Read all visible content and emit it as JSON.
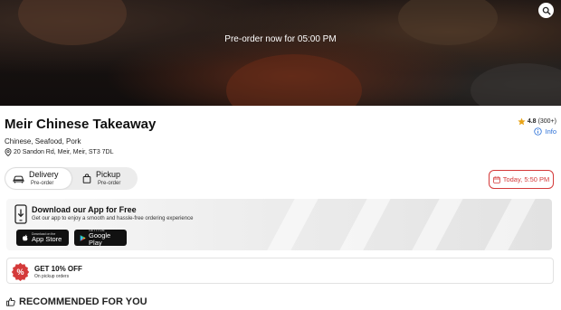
{
  "hero": {
    "preorder_text": "Pre-order now for 05:00 PM"
  },
  "restaurant": {
    "name": "Meir Chinese Takeaway",
    "cuisines": "Chinese, Seafood, Pork",
    "address": "20 Sandon Rd, Meir, Meir, ST3 7DL",
    "rating": "4.8",
    "rating_count": "(300+)",
    "info_label": "Info"
  },
  "order_mode": {
    "delivery": {
      "label": "Delivery",
      "sub": "Pre-order"
    },
    "pickup": {
      "label": "Pickup",
      "sub": "Pre-order"
    },
    "selected": "delivery"
  },
  "schedule": {
    "label": "Today, 5:50 PM"
  },
  "app_banner": {
    "title": "Download our App for Free",
    "subtitle": "Get our app to enjoy a smooth and hassle-free ordering experience",
    "app_store": {
      "top": "Download on the",
      "name": "App Store"
    },
    "google_play": {
      "top": "GET IT ON",
      "name": "Google Play"
    }
  },
  "offer": {
    "title": "GET 10% OFF",
    "subtitle": "On pickup orders",
    "badge": "%"
  },
  "recommended": {
    "title": "RECOMMENDED FOR YOU"
  },
  "colors": {
    "accent": "#d43a3a",
    "link": "#2a6fd6",
    "star": "#e8a317"
  }
}
